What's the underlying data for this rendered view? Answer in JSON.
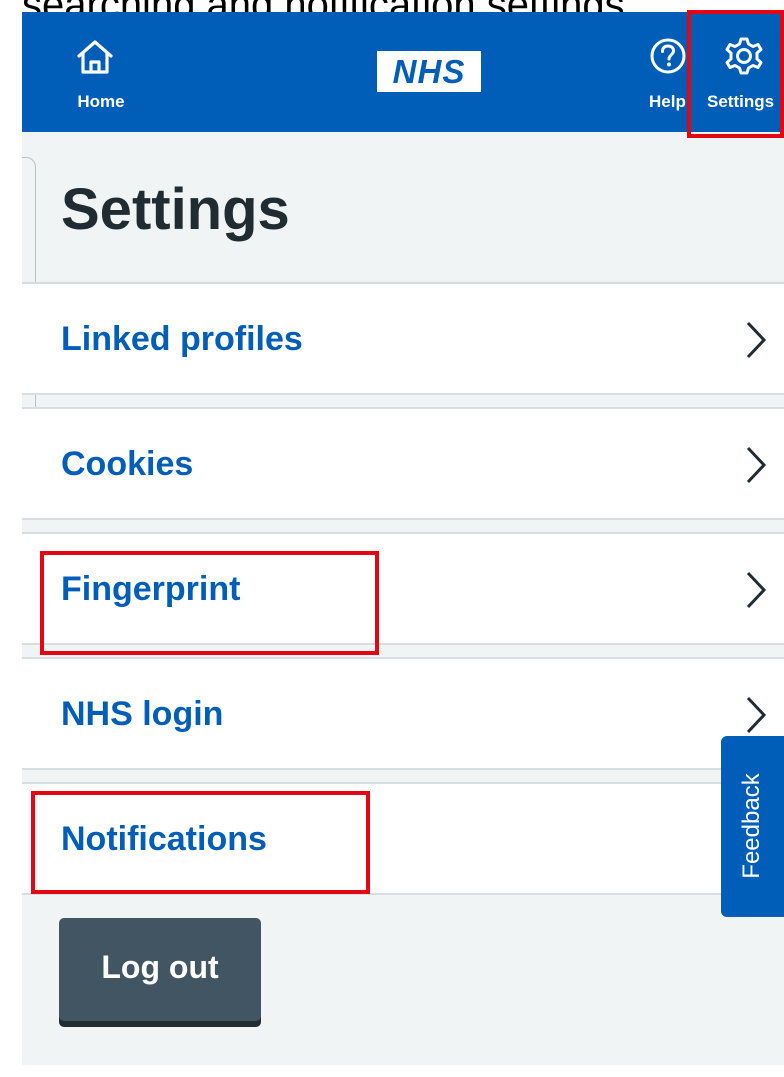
{
  "caption": "searching and notification settings.",
  "header": {
    "home_label": "Home",
    "logo_text": "NHS",
    "help_label": "Help",
    "settings_label": "Settings"
  },
  "page": {
    "title": "Settings"
  },
  "settings_items": [
    {
      "label": "Linked profiles",
      "icon": "chevron-right-icon"
    },
    {
      "label": "Cookies",
      "icon": "chevron-right-icon"
    },
    {
      "label": "Fingerprint",
      "icon": "chevron-right-icon"
    },
    {
      "label": "NHS login",
      "icon": "chevron-right-icon"
    },
    {
      "label": "Notifications",
      "icon": "chevron-right-icon"
    }
  ],
  "logout_label": "Log out",
  "feedback_label": "Feedback",
  "icons": {
    "home": "home-icon",
    "help": "help-circle-icon",
    "settings": "gear-icon"
  },
  "colors": {
    "brand_blue": "#005eb8",
    "page_background": "#f0f4f5",
    "text_dark": "#212b32",
    "button_dark": "#425563",
    "highlight_red": "#e30613"
  }
}
